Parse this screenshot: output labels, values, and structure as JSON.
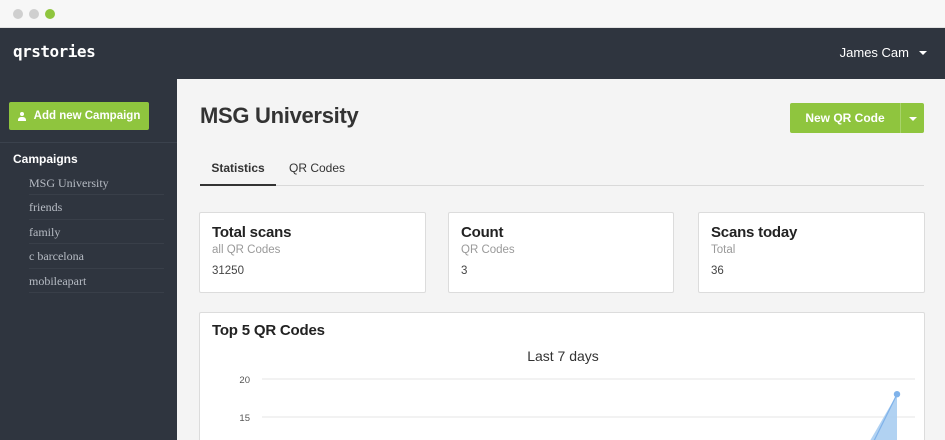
{
  "window": {
    "controls": [
      "close",
      "minimize",
      "maximize"
    ]
  },
  "nav": {
    "brand": "qrstories",
    "user_name": "James Cam"
  },
  "sidebar": {
    "add_button": "Add new Campaign",
    "heading": "Campaigns",
    "items": [
      {
        "label": "MSG University"
      },
      {
        "label": "friends"
      },
      {
        "label": "family"
      },
      {
        "label": "c barcelona"
      },
      {
        "label": "mobileapart"
      }
    ]
  },
  "main": {
    "title": "MSG University",
    "new_qr_button": "New QR Code",
    "tabs": [
      {
        "label": "Statistics",
        "active": true
      },
      {
        "label": "QR Codes",
        "active": false
      }
    ],
    "cards": [
      {
        "title": "Total scans",
        "subtitle": "all QR Codes",
        "value": "31250"
      },
      {
        "title": "Count",
        "subtitle": "QR Codes",
        "value": "3"
      },
      {
        "title": "Scans today",
        "subtitle": "Total",
        "value": "36"
      }
    ],
    "chart_heading": "Top 5 QR Codes"
  },
  "colors": {
    "accent": "#8fc53e",
    "nav_bg": "#2f353f",
    "series_fill": "#a9cdf1",
    "series_point": "#7fb2ea"
  },
  "chart_data": {
    "type": "area",
    "title": "Last 7 days",
    "xlabel": "",
    "ylabel": "",
    "y_ticks": [
      20,
      15
    ],
    "series": [
      {
        "values": [
          18
        ],
        "note_visible_only_last_point": true
      }
    ],
    "visible_last_value": 18,
    "grid": true
  }
}
